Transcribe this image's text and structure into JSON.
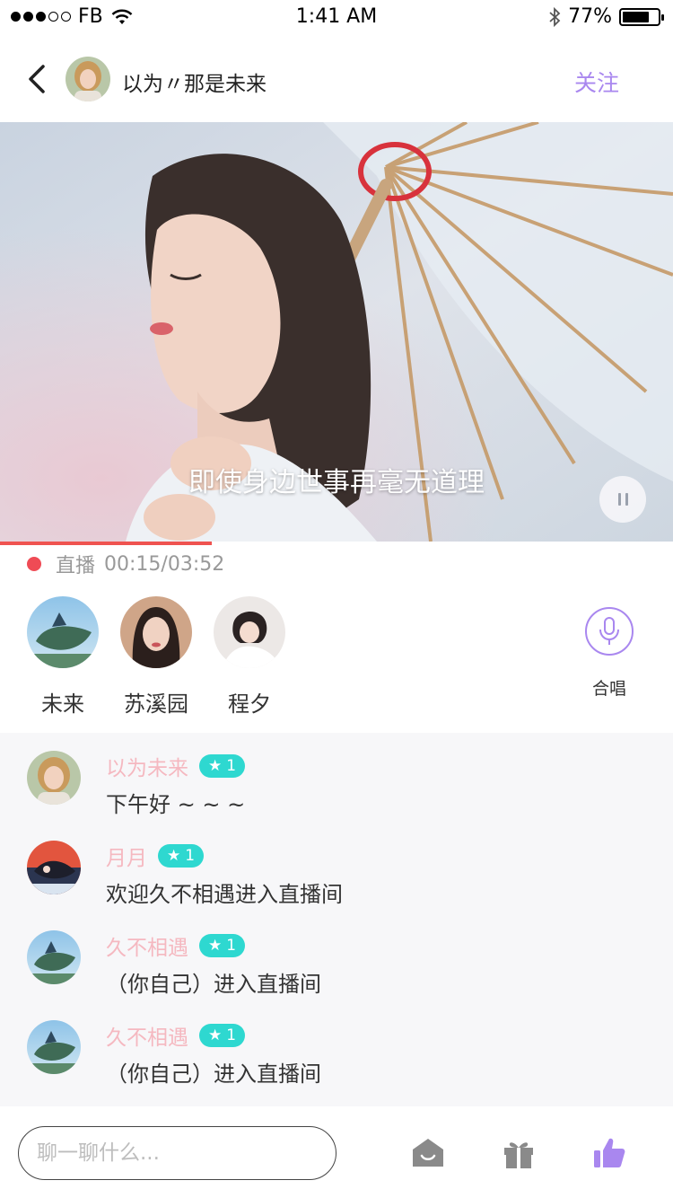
{
  "status_bar": {
    "carrier": "FB",
    "time": "1:41 AM",
    "battery": "77%",
    "battery_level": 0.77
  },
  "nav": {
    "title": "以为〃那是未来",
    "follow_label": "关注"
  },
  "player": {
    "lyric": "即使身边世事再毫无道理",
    "live_label": "直播",
    "time": "00:15/03:52",
    "progress": 0.315
  },
  "singers": [
    {
      "name": "未来"
    },
    {
      "name": "苏溪园"
    },
    {
      "name": "程夕"
    }
  ],
  "chorus_label": "合唱",
  "comments": [
    {
      "user": "以为未来",
      "level": "1",
      "text": "下午好 ~ ~ ~"
    },
    {
      "user": "月月",
      "level": "1",
      "text": "欢迎久不相遇进入直播间"
    },
    {
      "user": "久不相遇",
      "level": "1",
      "text": "（你自己）进入直播间"
    },
    {
      "user": "久不相遇",
      "level": "1",
      "text": "（你自己）进入直播间"
    }
  ],
  "input": {
    "placeholder": "聊一聊什么..."
  },
  "colors": {
    "accent": "#a987ef",
    "live_red": "#ef4b55",
    "username_pink": "#f5b8c0",
    "badge_teal": "#2ed8d0"
  }
}
